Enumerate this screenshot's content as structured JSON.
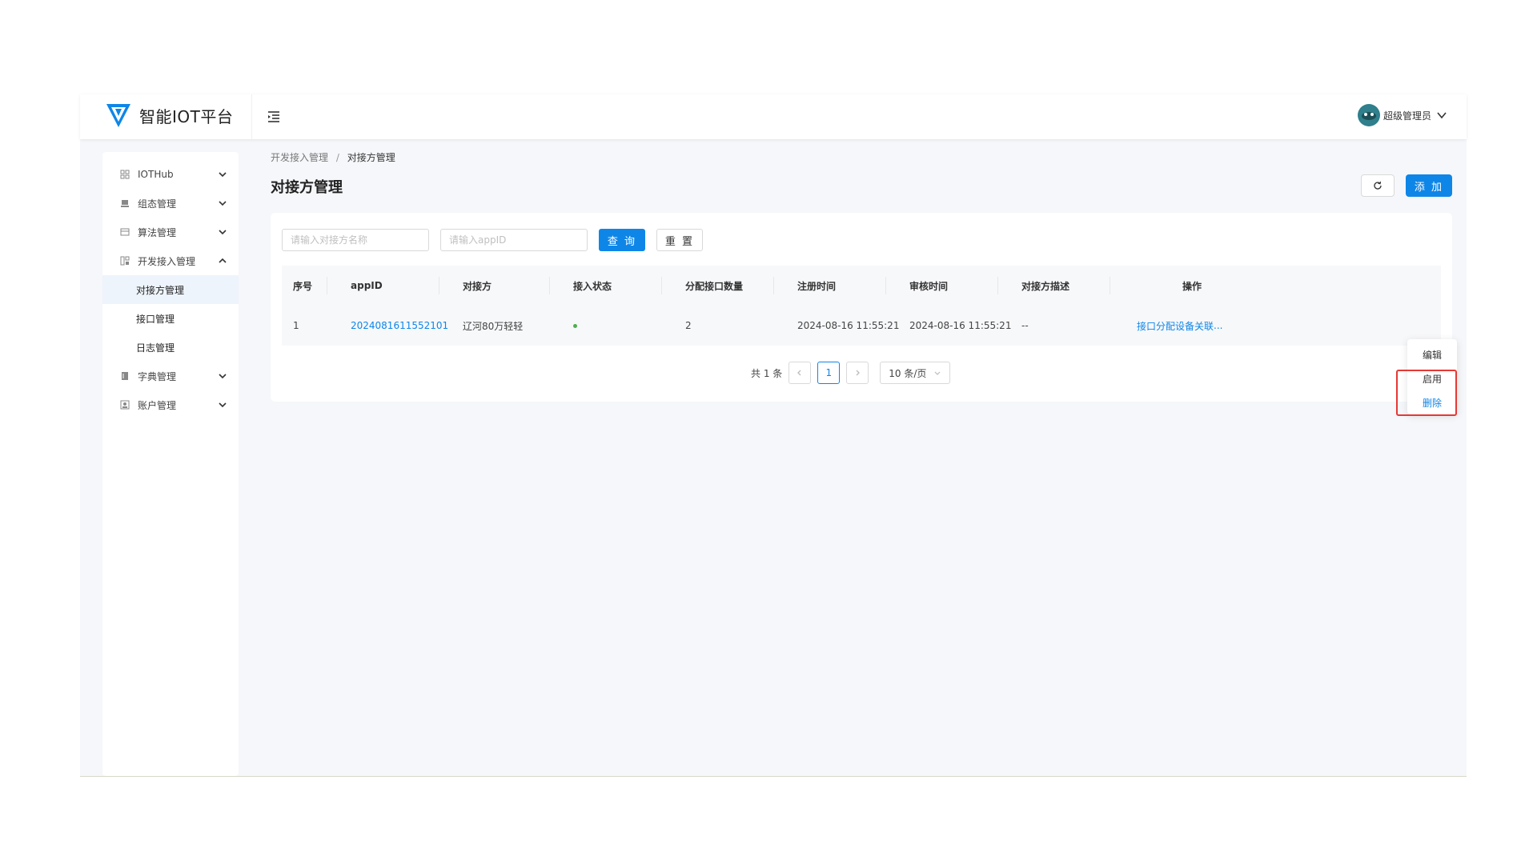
{
  "app": {
    "title": "智能IOT平台",
    "user_name": "超级管理员",
    "colors": {
      "primary": "#0e86e8",
      "highlight": "#e53935",
      "status_on": "#4caf50"
    }
  },
  "sidebar": {
    "items": [
      {
        "label": "IOTHub",
        "icon": "grid-icon",
        "expanded": false
      },
      {
        "label": "组态管理",
        "icon": "monitor-icon",
        "expanded": false
      },
      {
        "label": "算法管理",
        "icon": "card-icon",
        "expanded": false
      },
      {
        "label": "开发接入管理",
        "icon": "dashboard-icon",
        "expanded": true
      },
      {
        "label": "字典管理",
        "icon": "book-icon",
        "expanded": false
      },
      {
        "label": "账户管理",
        "icon": "account-icon",
        "expanded": false
      }
    ],
    "sub_items": [
      {
        "label": "对接方管理",
        "active": true
      },
      {
        "label": "接口管理",
        "active": false
      },
      {
        "label": "日志管理",
        "active": false
      }
    ]
  },
  "breadcrumb": {
    "parent": "开发接入管理",
    "separator": "/",
    "current": "对接方管理"
  },
  "page": {
    "title": "对接方管理",
    "add_label": "添 加"
  },
  "search": {
    "name_placeholder": "请输入对接方名称",
    "appid_placeholder": "请输入appID",
    "query_label": "查 询",
    "reset_label": "重 置"
  },
  "table": {
    "headers": [
      "序号",
      "appID",
      "对接方",
      "接入状态",
      "分配接口数量",
      "注册时间",
      "审核时间",
      "对接方描述",
      "操作"
    ],
    "rows": [
      {
        "index": "1",
        "appid": "2024081611552101",
        "partner": "辽河80万轻轻",
        "status": "enabled",
        "api_count": "2",
        "register_time": "2024-08-16 11:55:21",
        "review_time": "2024-08-16 11:55:21",
        "description": "--",
        "actions": {
          "assign": "接口分配",
          "device": "设备关联",
          "more": "..."
        }
      }
    ]
  },
  "pagination": {
    "total_text": "共 1 条",
    "current_page": "1",
    "page_size": "10 条/页"
  },
  "dropdown": {
    "items": [
      "编辑",
      "启用",
      "删除"
    ]
  }
}
